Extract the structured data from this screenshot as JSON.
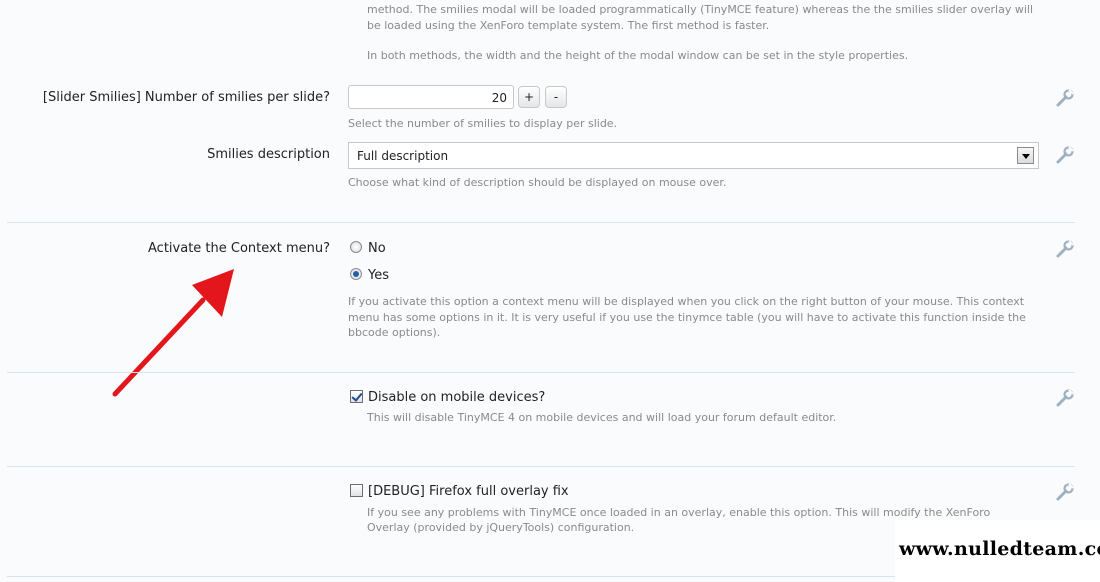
{
  "intro": {
    "line1": "method. The smilies modal will be loaded programmatically (TinyMCE feature) whereas the the smilies slider overlay will",
    "line2": "be loaded using the XenForo template system. The first method is faster.",
    "line3": "In both methods, the width and the height of the modal window can be set in the style properties."
  },
  "slider_smilies": {
    "label": "[Slider Smilies] Number of smilies per slide?",
    "value": "20",
    "plus_label": "+",
    "minus_label": "-",
    "hint": "Select the number of smilies to display per slide."
  },
  "smilies_description": {
    "label": "Smilies description",
    "selected": "Full description",
    "hint": "Choose what kind of description should be displayed on mouse over."
  },
  "context_menu": {
    "label": "Activate the Context menu?",
    "options": [
      {
        "label": "No",
        "checked": false
      },
      {
        "label": "Yes",
        "checked": true
      }
    ],
    "hint_line1": "If you activate this option a context menu will be displayed when you click on the right button of your mouse. This context",
    "hint_line2": "menu has some options in it. It is very useful if you use the tinymce table (you will have to activate this function inside the",
    "hint_line3": "bbcode options)."
  },
  "mobile": {
    "label": "Disable on mobile devices?",
    "checked": true,
    "hint": "This will disable TinyMCE 4 on mobile devices and will load your forum default editor."
  },
  "firefox_fix": {
    "label": "[DEBUG] Firefox full overlay fix",
    "checked": false,
    "hint_line1": "If you see any problems with TinyMCE once loaded in an overlay, enable this option. This will modify the XenForo",
    "hint_line2": "Overlay (provided by jQueryTools) configuration."
  },
  "colors": {
    "arrow": "#e3161b",
    "separator": "#d7e4ee",
    "hint_text": "#8a8a8a"
  },
  "icons": {
    "edit": "wrench-icon",
    "annotation": "red-arrow"
  },
  "watermark": "www.nulledteam.com"
}
